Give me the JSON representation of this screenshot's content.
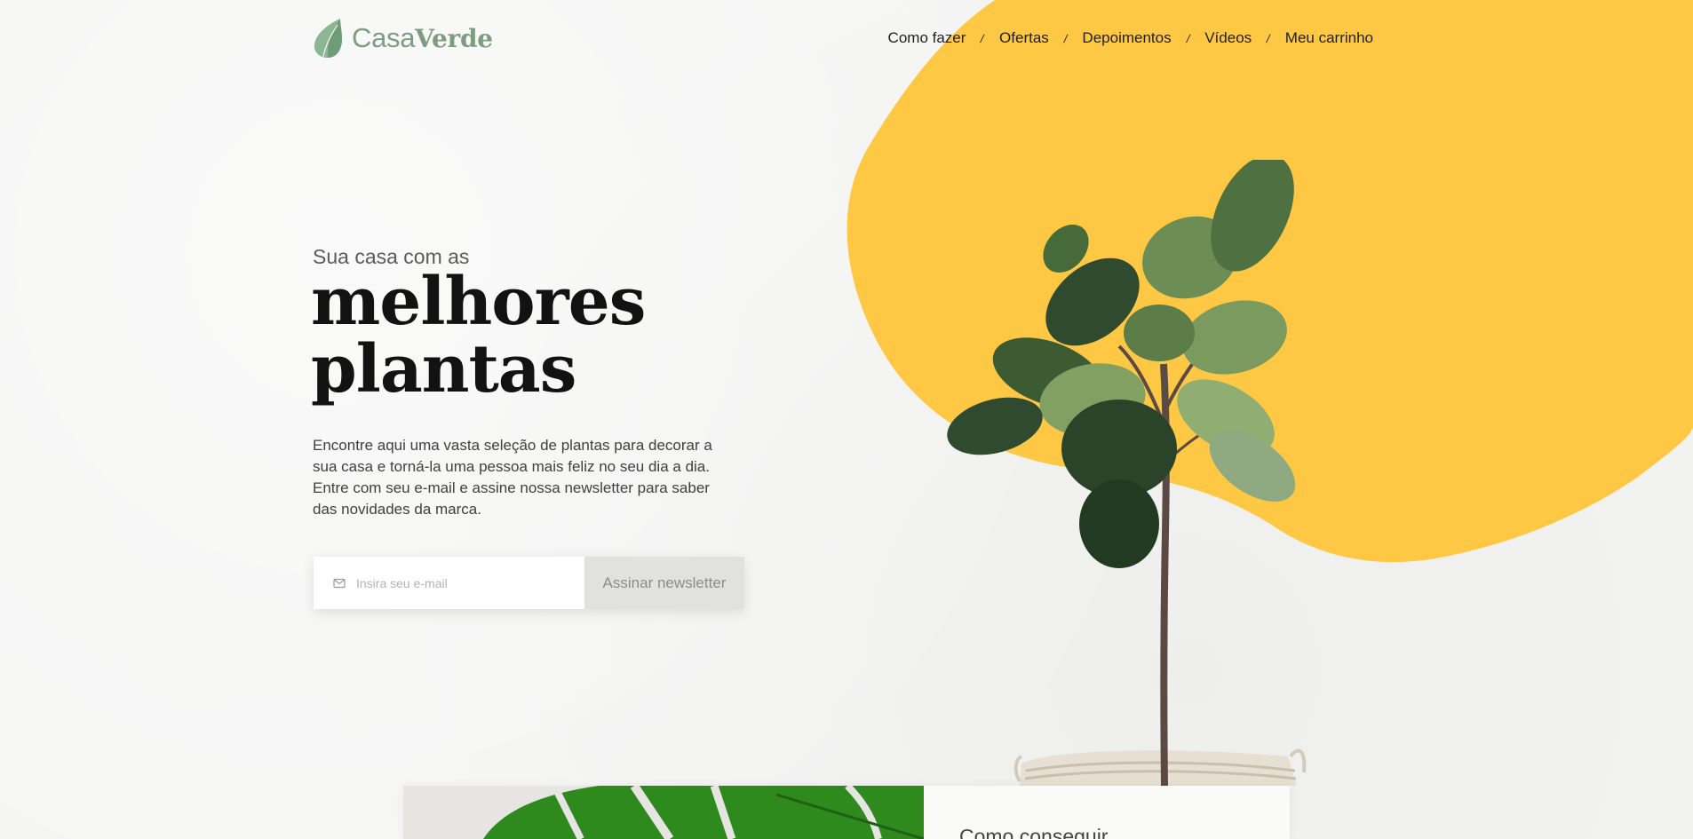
{
  "brand": {
    "name_light": "Casa",
    "name_bold": "Verde",
    "icon": "leaf-icon",
    "color": "#7d9c84"
  },
  "nav": {
    "items": [
      {
        "label": "Como fazer"
      },
      {
        "label": "Ofertas"
      },
      {
        "label": "Depoimentos"
      },
      {
        "label": "Vídeos"
      },
      {
        "label": "Meu carrinho"
      }
    ],
    "separator": "/"
  },
  "hero": {
    "kicker": "Sua casa com as",
    "title_line1": "melhores",
    "title_line2": "plantas",
    "description": "Encontre aqui uma vasta seleção de plantas para decorar a sua casa e torná-la uma pessoa mais feliz no seu dia a dia. Entre com seu e-mail e assine nossa newsletter para saber das novidades da marca.",
    "image": "fiddle-leaf-fig-plant",
    "accent_color": "#ffc844"
  },
  "newsletter": {
    "email_placeholder": "Insira seu e-mail",
    "email_icon": "mail-icon",
    "button_label": "Assinar newsletter"
  },
  "next_section": {
    "title": "Como conseguir",
    "image": "monstera-leaves"
  }
}
